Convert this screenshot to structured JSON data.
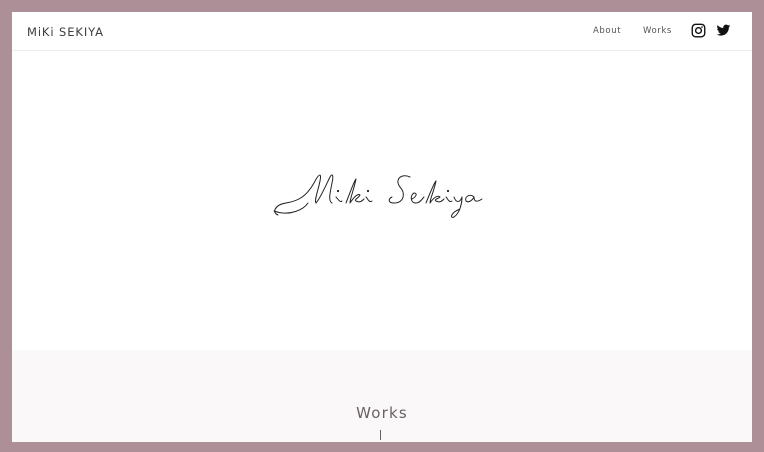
{
  "header": {
    "logo": "MiKi SEKIYA",
    "nav": [
      {
        "label": "About"
      },
      {
        "label": "Works"
      }
    ],
    "social": [
      {
        "icon": "instagram-icon"
      },
      {
        "icon": "twitter-icon"
      }
    ]
  },
  "works": {
    "title": "Works"
  },
  "colors": {
    "frame_border": "#ad8f97",
    "text_dark": "#3d3d3d",
    "section_bg": "#faf8f9"
  }
}
